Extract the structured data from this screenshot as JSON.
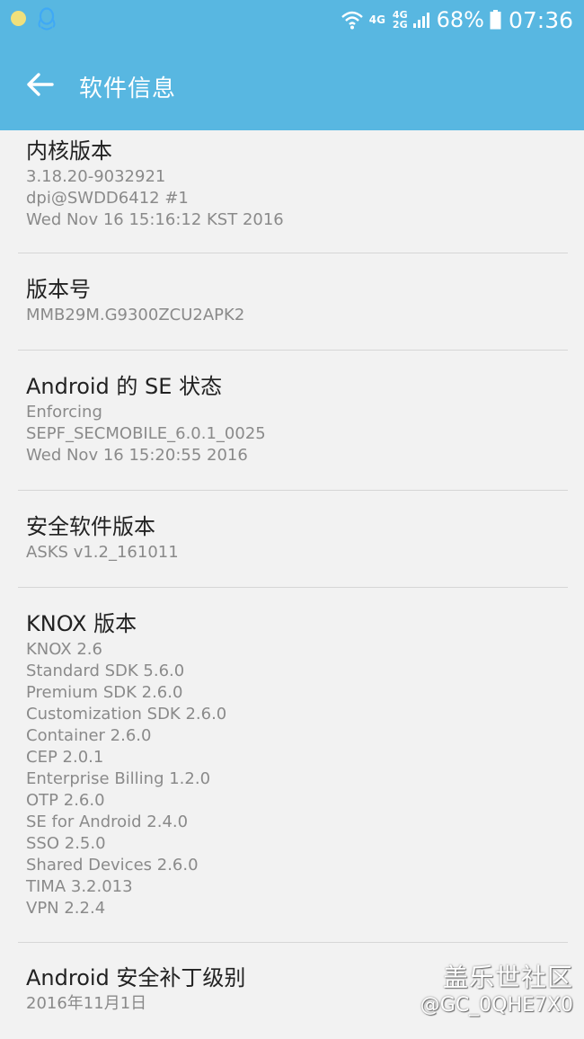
{
  "status_bar": {
    "net_type_1": "4G",
    "net_type_2_top": "4G",
    "net_type_2_bottom": "2G",
    "battery": "68%",
    "time": "07:36",
    "icons": [
      "notification-dot-icon",
      "qq-icon",
      "wifi-icon",
      "signal-icon",
      "battery-icon"
    ]
  },
  "app_bar": {
    "title": "软件信息",
    "back_icon": "arrow-left-icon"
  },
  "sections": [
    {
      "title": "内核版本",
      "lines": [
        "3.18.20-9032921",
        "dpi@SWDD6412 #1",
        "Wed Nov 16 15:16:12 KST 2016"
      ]
    },
    {
      "title": "版本号",
      "lines": [
        "MMB29M.G9300ZCU2APK2"
      ]
    },
    {
      "title": "Android 的 SE 状态",
      "lines": [
        "Enforcing",
        "SEPF_SECMOBILE_6.0.1_0025",
        "Wed Nov 16 15:20:55 2016"
      ]
    },
    {
      "title": "安全软件版本",
      "lines": [
        "ASKS v1.2_161011"
      ]
    },
    {
      "title": "KNOX 版本",
      "lines": [
        "KNOX 2.6",
        "Standard SDK 5.6.0",
        "Premium SDK 2.6.0",
        "Customization SDK 2.6.0",
        "Container 2.6.0",
        "CEP 2.0.1",
        "Enterprise Billing 1.2.0",
        "OTP 2.6.0",
        "SE for Android 2.4.0",
        "SSO 2.5.0",
        "Shared Devices 2.6.0",
        "TIMA 3.2.013",
        "VPN 2.2.4"
      ]
    },
    {
      "title": "Android 安全补丁级别",
      "lines": [
        "2016年11月1日"
      ]
    }
  ],
  "watermark": {
    "brand": "盖乐世社区",
    "user": "@GC_0QHE7X0"
  },
  "colors": {
    "app_bar": "#58b7e1",
    "background": "#f2f2f2",
    "title_text": "#222222",
    "secondary_text": "#8a8a8a"
  }
}
